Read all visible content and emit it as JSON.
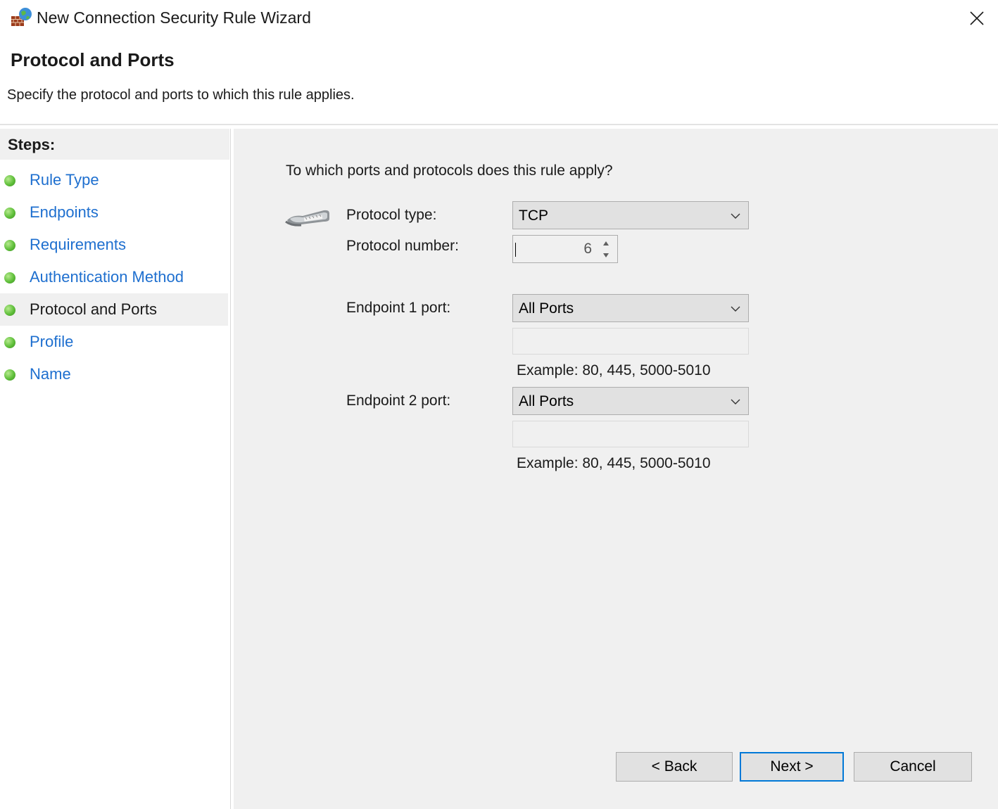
{
  "window": {
    "title": "New Connection Security Rule Wizard",
    "icon": "firewall-globe-icon",
    "close_icon": "close-icon"
  },
  "header": {
    "title": "Protocol and Ports",
    "description": "Specify the protocol and ports to which this rule applies."
  },
  "steps": {
    "title": "Steps:",
    "items": [
      {
        "label": "Rule Type",
        "active": false
      },
      {
        "label": "Endpoints",
        "active": false
      },
      {
        "label": "Requirements",
        "active": false
      },
      {
        "label": "Authentication Method",
        "active": false
      },
      {
        "label": "Protocol and Ports",
        "active": true
      },
      {
        "label": "Profile",
        "active": false
      },
      {
        "label": "Name",
        "active": false
      }
    ]
  },
  "content": {
    "question": "To which ports and protocols does this rule apply?",
    "protocol_type": {
      "label": "Protocol type:",
      "value": "TCP"
    },
    "protocol_number": {
      "label": "Protocol number:",
      "value": "6"
    },
    "endpoint1": {
      "label": "Endpoint 1 port:",
      "value": "All Ports",
      "text": "",
      "example": "Example: 80, 445, 5000-5010"
    },
    "endpoint2": {
      "label": "Endpoint 2 port:",
      "value": "All Ports",
      "text": "",
      "example": "Example: 80, 445, 5000-5010"
    }
  },
  "buttons": {
    "back": "< Back",
    "next": "Next >",
    "cancel": "Cancel"
  },
  "colors": {
    "link": "#1e6fcf",
    "accent": "#0078d7",
    "panel": "#f0f0f0",
    "step_dot": "#5fbf3a"
  }
}
